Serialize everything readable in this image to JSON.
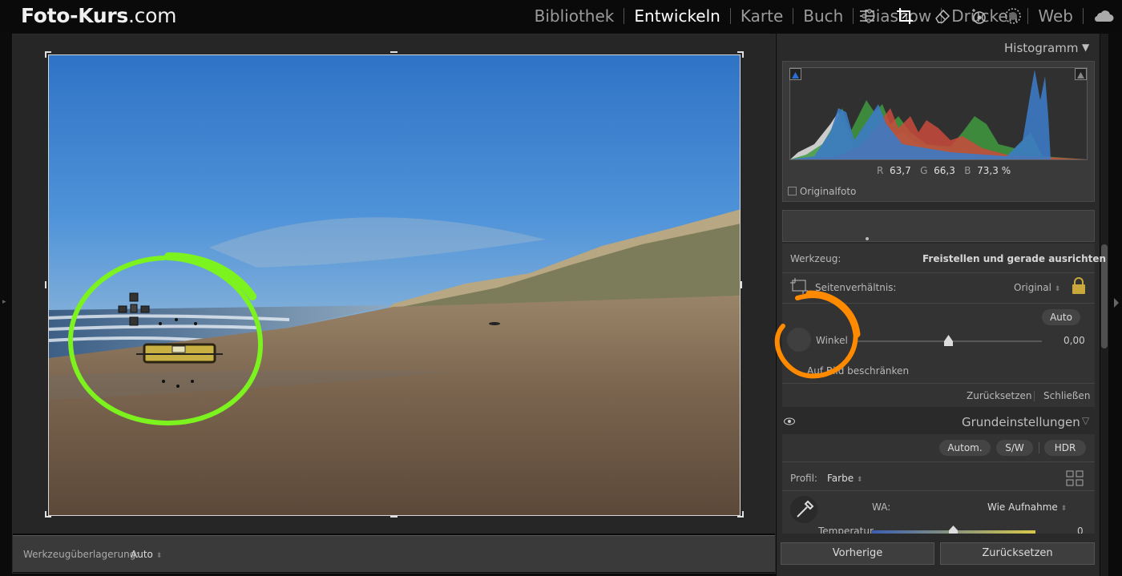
{
  "brand": {
    "bold": "Foto-Kurs",
    "rest": ".com"
  },
  "modules": [
    {
      "label": "Bibliothek",
      "active": false
    },
    {
      "label": "Entwickeln",
      "active": true
    },
    {
      "label": "Karte",
      "active": false
    },
    {
      "label": "Buch",
      "active": false
    },
    {
      "label": "Diashow",
      "active": false
    },
    {
      "label": "Drucken",
      "active": false
    },
    {
      "label": "Web",
      "active": false
    }
  ],
  "toolbar": {
    "overlay_label": "Werkzeugüberlagerung:",
    "overlay_value": "Auto"
  },
  "histogram": {
    "title": "Histogramm",
    "r_label": "R",
    "r_value": "63,7",
    "g_label": "G",
    "g_value": "66,3",
    "b_label": "B",
    "b_value": "73,3 %",
    "original_label": "Originalfoto"
  },
  "crop": {
    "tool_label": "Werkzeug:",
    "tool_value": "Freistellen und gerade ausrichten",
    "aspect_label": "Seitenverhältnis:",
    "aspect_value": "Original",
    "auto_button": "Auto",
    "angle_label": "Winkel",
    "angle_value": "0,00",
    "constrain_label": "Auf Bild beschränken",
    "reset_button": "Zurücksetzen",
    "close_button": "Schließen"
  },
  "basic": {
    "title": "Grundeinstellungen",
    "auto_button": "Autom.",
    "bw_button": "S/W",
    "hdr_button": "HDR",
    "profile_label": "Profil:",
    "profile_value": "Farbe",
    "wb_label": "WA:",
    "wb_value": "Wie Aufnahme",
    "temp_label": "Temperatur",
    "temp_value": "0"
  },
  "footer": {
    "previous_button": "Vorherige",
    "reset_button": "Zurücksetzen"
  },
  "colors": {
    "highlight_green": "#7cf21e",
    "highlight_orange": "#ff8a00",
    "accent_blue": "#2a6fd6"
  }
}
